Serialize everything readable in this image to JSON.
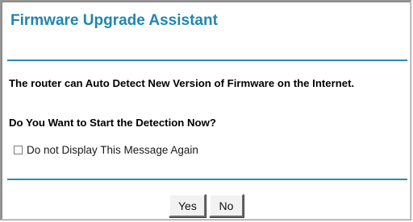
{
  "dialog": {
    "title": "Firmware Upgrade Assistant",
    "message_line1": "The router can Auto Detect New Version of Firmware on the Internet.",
    "message_line2": "Do You Want to Start the Detection Now?",
    "checkbox_label": "Do not Display This Message Again",
    "checkbox_checked": false
  },
  "buttons": {
    "yes_label": "Yes",
    "no_label": "No"
  },
  "colors": {
    "title": "#1f86b0",
    "rule": "#2a8ab7"
  }
}
